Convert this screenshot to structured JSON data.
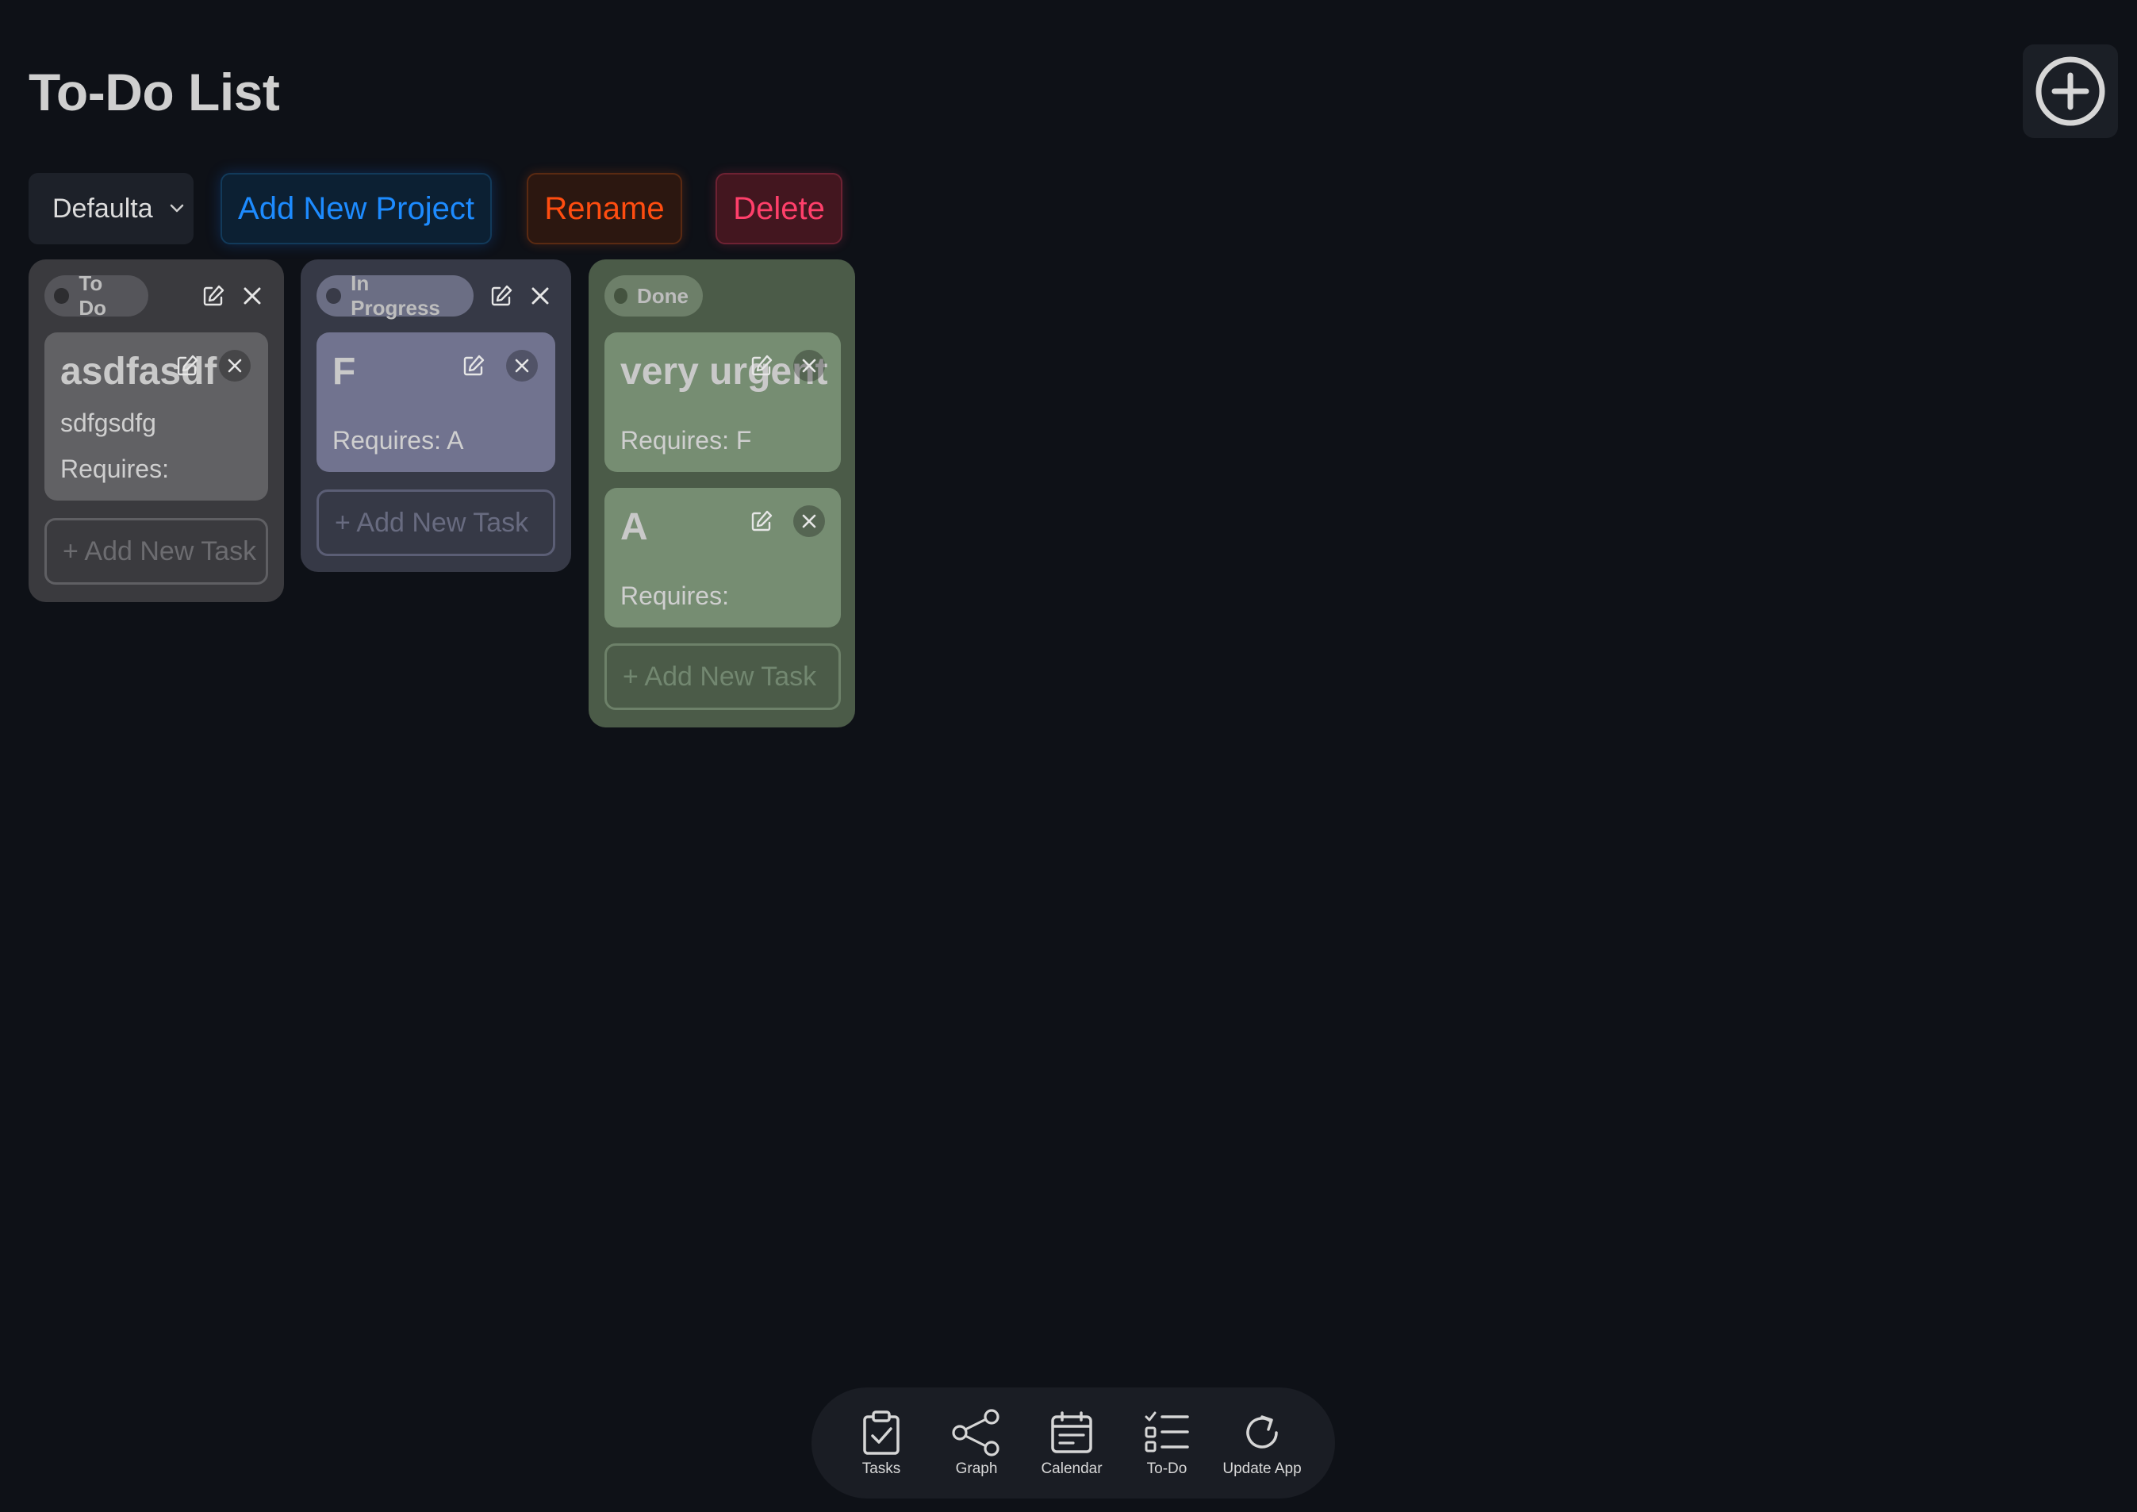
{
  "header": {
    "title": "To-Do List"
  },
  "toolbar": {
    "project_select_value": "Defaulta",
    "add_project_label": "Add New Project",
    "rename_label": "Rename",
    "delete_label": "Delete"
  },
  "columns": [
    {
      "name": "To Do",
      "tasks": [
        {
          "title": "asdfasdf",
          "description": "sdfgsdfg",
          "requires": "Requires:"
        }
      ],
      "add_task_label": "+ Add New Task"
    },
    {
      "name": "In Progress",
      "tasks": [
        {
          "title": "F",
          "description": "",
          "requires": "Requires: A"
        }
      ],
      "add_task_label": "+ Add New Task"
    },
    {
      "name": "Done",
      "tasks": [
        {
          "title": "very urgent",
          "description": "",
          "requires": "Requires: F"
        },
        {
          "title": "A",
          "description": "",
          "requires": "Requires:"
        }
      ],
      "add_task_label": "+ Add New Task"
    }
  ],
  "bottom_nav": {
    "items": [
      {
        "label": "Tasks",
        "icon": "clipboard-check-icon"
      },
      {
        "label": "Graph",
        "icon": "share-graph-icon"
      },
      {
        "label": "Calendar",
        "icon": "calendar-icon"
      },
      {
        "label": "To-Do",
        "icon": "checklist-icon"
      },
      {
        "label": "Update App",
        "icon": "refresh-icon"
      }
    ]
  },
  "colors": {
    "background": "#0e1117",
    "add_project": "#1d8bff",
    "rename": "#ff4d10",
    "delete": "#ff3f6a",
    "todo_column": "#3a3a3e",
    "in_progress_column": "#363946",
    "done_column": "#4b5b48"
  }
}
